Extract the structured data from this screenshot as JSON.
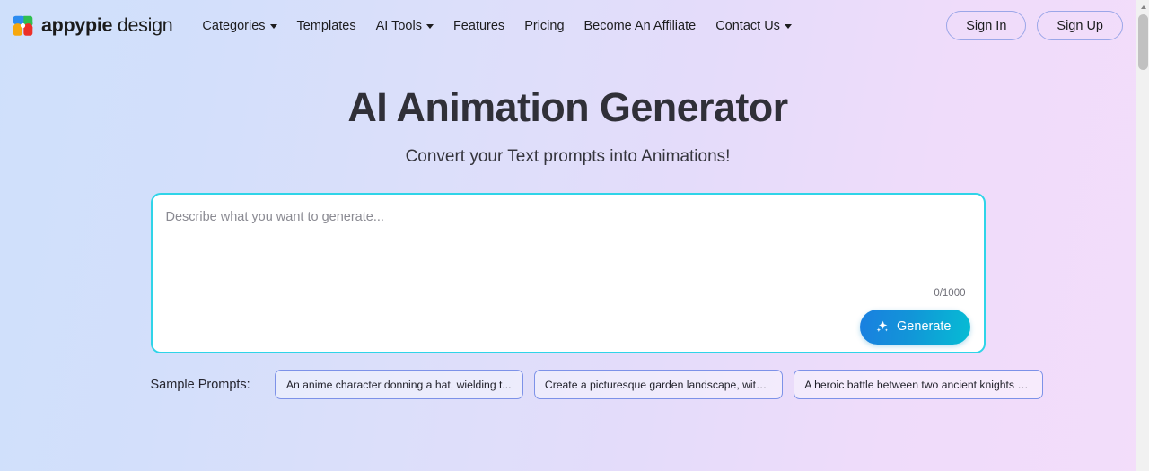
{
  "header": {
    "brand": {
      "bold": "appypie",
      "light": "design",
      "logo_icon": "appypie-flower-logo"
    },
    "nav": [
      {
        "label": "Categories",
        "has_dropdown": true
      },
      {
        "label": "Templates",
        "has_dropdown": false
      },
      {
        "label": "AI Tools",
        "has_dropdown": true
      },
      {
        "label": "Features",
        "has_dropdown": false
      },
      {
        "label": "Pricing",
        "has_dropdown": false
      },
      {
        "label": "Become An Affiliate",
        "has_dropdown": false
      },
      {
        "label": "Contact Us",
        "has_dropdown": true
      }
    ],
    "sign_in_label": "Sign In",
    "sign_up_label": "Sign Up"
  },
  "hero": {
    "title": "AI Animation Generator",
    "subtitle": "Convert your Text prompts into Animations!"
  },
  "prompt": {
    "placeholder": "Describe what you want to generate...",
    "value": "",
    "char_count": "0/1000",
    "generate_label": "Generate",
    "generate_icon": "sparkle-icon"
  },
  "samples": {
    "label": "Sample Prompts:",
    "items": [
      "An anime character donning a hat, wielding t...",
      "Create a picturesque garden landscape, with ...",
      "A heroic battle between two ancient knights o..."
    ]
  },
  "colors": {
    "accent_cyan": "#2fd4e8",
    "generate_gradient_start": "#1a7fe0",
    "generate_gradient_end": "#06bcd4",
    "pill_border": "#9ba6e8",
    "chip_border": "#7d92e8",
    "bg_gradient_left": "#cfe0fb",
    "bg_gradient_right": "#f3ddfa",
    "logo_blue": "#2d8cf0",
    "logo_green": "#2fbf4f",
    "logo_orange": "#f7a80d",
    "logo_red": "#ec2f28"
  }
}
